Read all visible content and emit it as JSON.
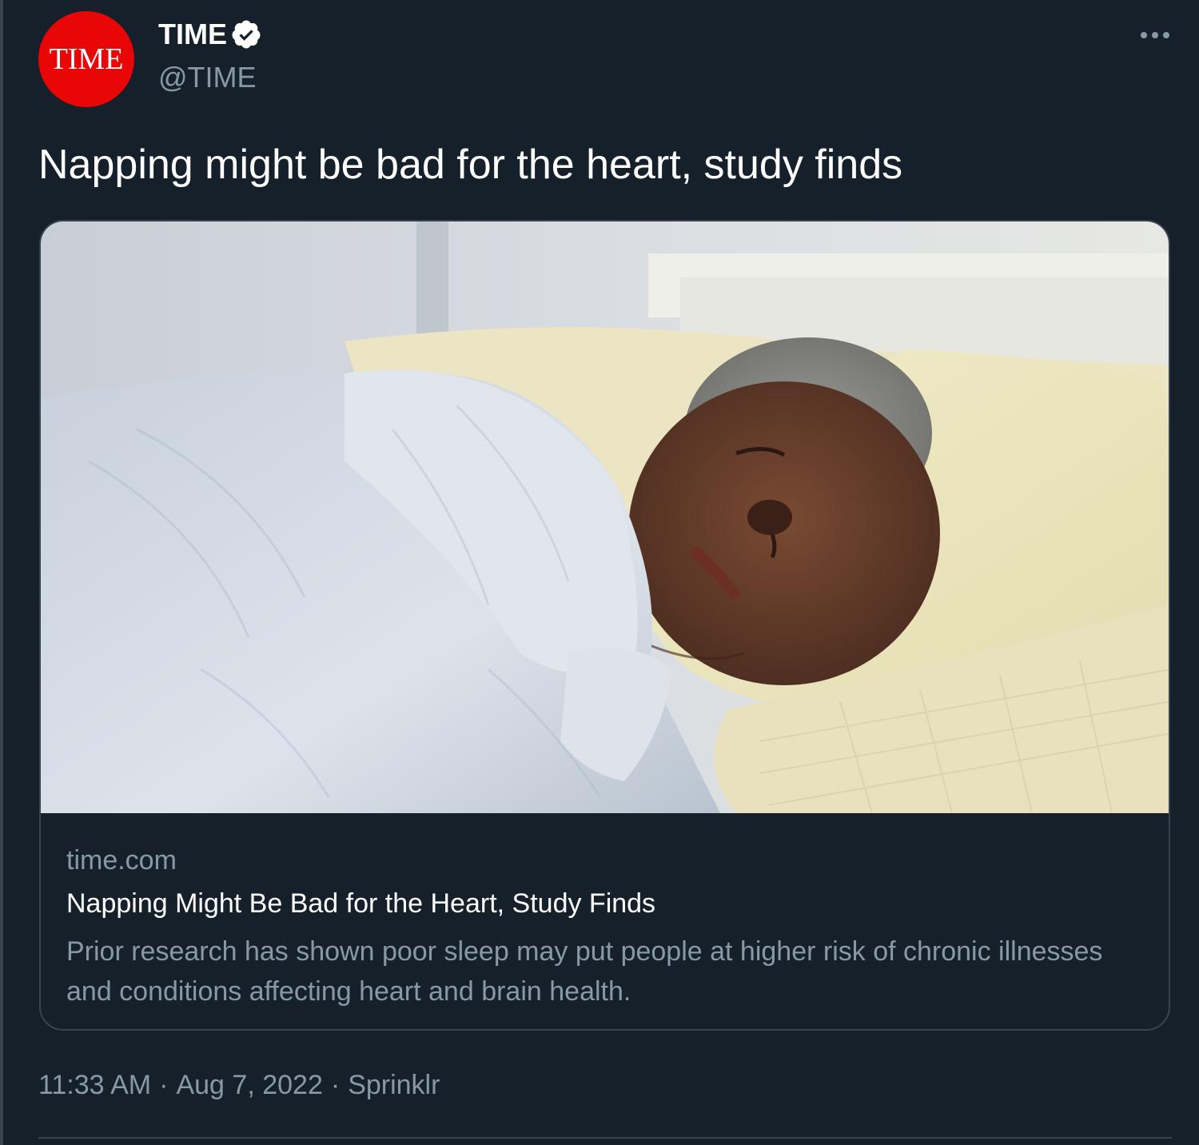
{
  "author": {
    "avatar_text": "TIME",
    "display_name": "TIME",
    "handle": "@TIME",
    "verified": true
  },
  "tweet": {
    "text": "Napping might be bad for the heart, study finds"
  },
  "card": {
    "domain": "time.com",
    "title": "Napping Might Be Bad for the Heart, Study Finds",
    "description": "Prior research has shown poor sleep may put people at higher risk of chronic illnesses and conditions affecting heart and brain health."
  },
  "meta": {
    "time": "11:33 AM",
    "date": "Aug 7, 2022",
    "source": "Sprinklr",
    "separator": "·"
  },
  "icons": {
    "verified": "verified-badge-icon",
    "more": "more-options-icon"
  },
  "colors": {
    "background": "#15202b",
    "brand_red": "#e90606",
    "secondary_text": "#8899a6",
    "border": "#38444d"
  }
}
